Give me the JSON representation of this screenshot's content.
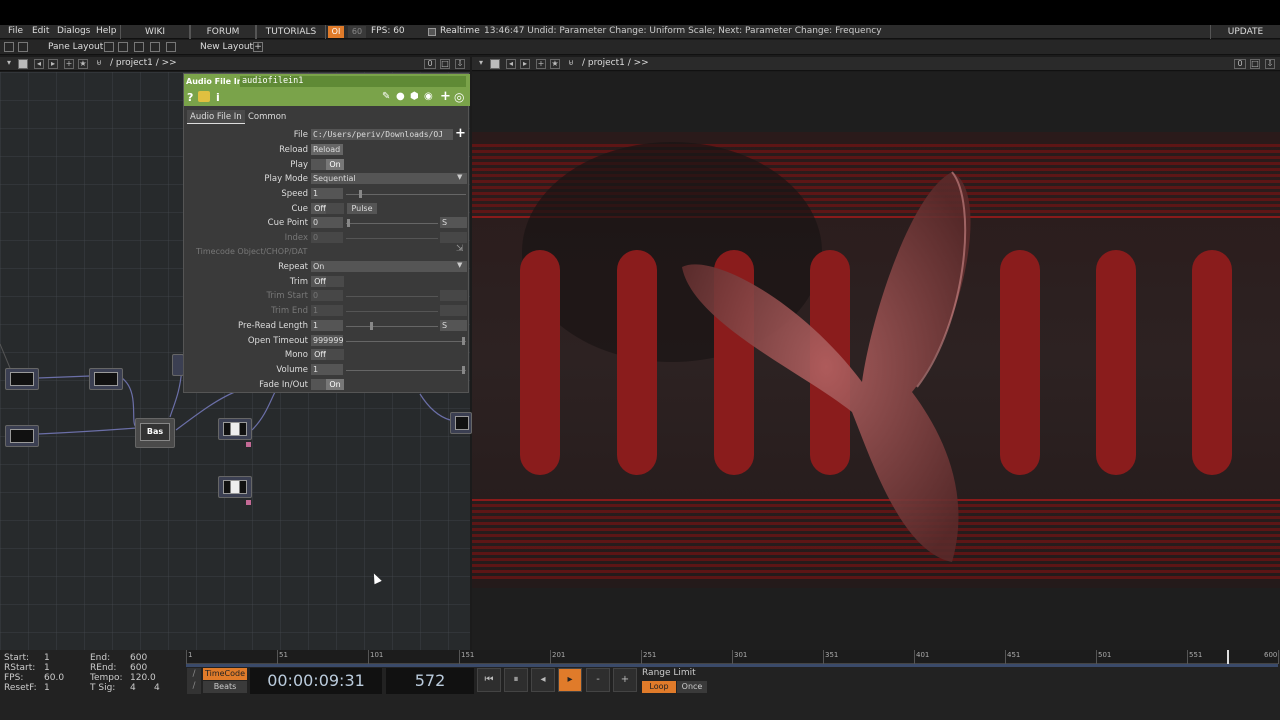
{
  "menu": {
    "file": "File",
    "edit": "Edit",
    "dialogs": "Dialogs",
    "help": "Help",
    "wiki": "WIKI",
    "forum": "FORUM",
    "tutorials": "TUTORIALS",
    "oi": "OI",
    "fps_box": "60",
    "fps": "FPS: 60",
    "realtime": "Realtime",
    "status": "13:46:47 Undid: Parameter Change: Uniform Scale; Next: Parameter Change: Frequency",
    "update": "UPDATE"
  },
  "layout": {
    "pane_layout": "Pane Layout",
    "new_layout": "New Layout",
    "plus": "+"
  },
  "left_pane": {
    "path": "/ project1 / >>",
    "count": "0"
  },
  "right_pane": {
    "path": "/ project1 / >>",
    "count": "0"
  },
  "network": {
    "bas_node": "Bas"
  },
  "param": {
    "op_type": "Audio File In",
    "op_name": "audiofilein1",
    "tabs": [
      "Audio File In",
      "Common"
    ],
    "file_label": "File",
    "file_value": "C:/Users/periv/Downloads/OJ",
    "reload_label": "Reload",
    "reload_button": "Reload",
    "play_label": "Play",
    "play_value": "On",
    "playmode_label": "Play Mode",
    "playmode_value": "Sequential",
    "speed_label": "Speed",
    "speed_value": "1",
    "cue_label": "Cue",
    "cue_value": "Off",
    "cue_pulse": "Pulse",
    "cuepoint_label": "Cue Point",
    "cuepoint_value": "0",
    "cuepoint_unit": "S",
    "index_label": "Index",
    "index_value": "0",
    "timecode_label": "Timecode Object/CHOP/DAT",
    "repeat_label": "Repeat",
    "repeat_value": "On",
    "trim_label": "Trim",
    "trim_value": "Off",
    "trimstart_label": "Trim Start",
    "trimstart_value": "0",
    "trimend_label": "Trim End",
    "trimend_value": "1",
    "preread_label": "Pre-Read Length",
    "preread_value": "1",
    "preread_unit": "S",
    "timeout_label": "Open Timeout",
    "timeout_value": "999999",
    "mono_label": "Mono",
    "mono_value": "Off",
    "volume_label": "Volume",
    "volume_value": "1",
    "fade_label": "Fade In/Out",
    "fade_value": "On"
  },
  "timeline": {
    "start_label": "Start:",
    "start_value": "1",
    "end_label": "End:",
    "end_value": "600",
    "rstart_label": "RStart:",
    "rstart_value": "1",
    "rend_label": "REnd:",
    "rend_value": "600",
    "fps_label": "FPS:",
    "fps_value": "60.0",
    "tempo_label": "Tempo:",
    "tempo_value": "120.0",
    "resetf_label": "ResetF:",
    "resetf_value": "1",
    "tsig_label": "T Sig:",
    "tsig_a": "4",
    "tsig_b": "4",
    "ruler": [
      "1",
      "51",
      "101",
      "151",
      "201",
      "251",
      "301",
      "351",
      "401",
      "451",
      "501",
      "551",
      "600"
    ],
    "timecode_btn": "TimeCode",
    "beats_btn": "Beats",
    "timecode": "00:00:09:31",
    "frame": "572",
    "range_limit": "Range Limit",
    "loop": "Loop",
    "once": "Once",
    "playhead_fraction": 0.953
  }
}
